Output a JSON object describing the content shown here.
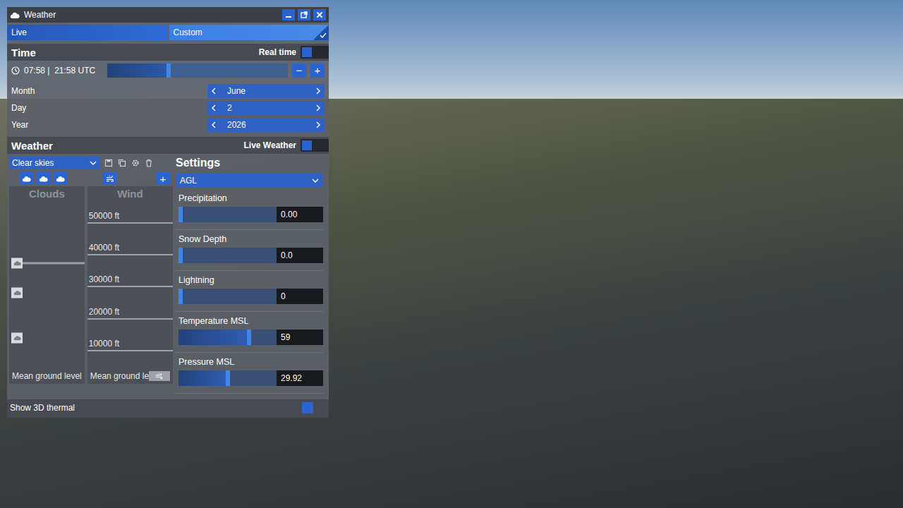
{
  "window": {
    "title": "Weather"
  },
  "mode_tabs": [
    {
      "label": "Live",
      "selected": false
    },
    {
      "label": "Custom",
      "selected": true
    }
  ],
  "time": {
    "title": "Time",
    "real_time": {
      "label": "Real time",
      "on": false
    },
    "clock": "07:58 |  21:58 UTC",
    "level": 0.33,
    "minus": "−",
    "plus": "+"
  },
  "date_fields": [
    {
      "label": "Month",
      "value": "June"
    },
    {
      "label": "Day",
      "value": "2"
    },
    {
      "label": "Year",
      "value": "2026"
    }
  ],
  "weather": {
    "title": "Weather",
    "live_weather": {
      "label": "Live Weather",
      "on": false
    },
    "preset": "Clear skies",
    "add": "+"
  },
  "clouds": {
    "title": "Clouds",
    "ground": "Mean ground level",
    "layers": [
      {
        "level": 0.63,
        "selected": true
      },
      {
        "level": 0.45,
        "selected": false
      },
      {
        "level": 0.18,
        "selected": false
      }
    ]
  },
  "wind": {
    "title": "Wind",
    "ground": "Mean ground le",
    "ticks": [
      "50000 ft",
      "40000 ft",
      "30000 ft",
      "20000 ft",
      "10000 ft"
    ]
  },
  "settings": {
    "title": "Settings",
    "reference": "AGL",
    "sliders": [
      {
        "label": "Precipitation",
        "value": "0.00",
        "level": 0.0
      },
      {
        "label": "Snow Depth",
        "value": "0.0",
        "level": 0.0
      },
      {
        "label": "Lightning",
        "value": "0",
        "level": 0.0
      },
      {
        "label": "Temperature MSL",
        "value": "59",
        "level": 0.7
      },
      {
        "label": "Pressure MSL",
        "value": "29.92",
        "level": 0.48
      }
    ]
  },
  "thermal": {
    "label": "Show 3D thermal",
    "on": false
  }
}
